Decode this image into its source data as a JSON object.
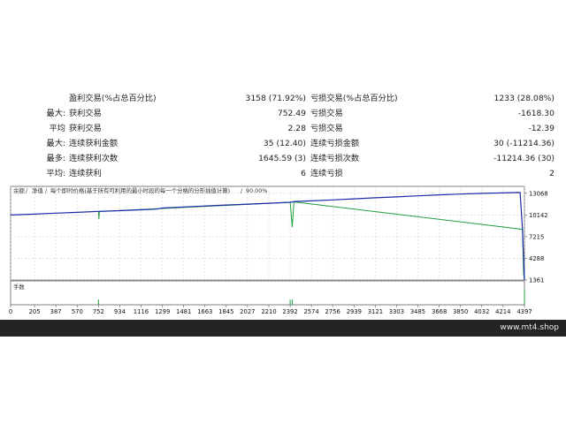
{
  "stats": {
    "rows": [
      {
        "prefix": "",
        "label1": "盈利交易(%占总百分比)",
        "value1": "3158 (71.92%)",
        "label2": "亏损交易(%占总百分比)",
        "value2": "1233 (28.08%)"
      },
      {
        "prefix": "最大:",
        "label1": "获利交易",
        "value1": "752.49",
        "label2": "亏损交易",
        "value2": "-1618.30"
      },
      {
        "prefix": "平均",
        "label1": "获利交易",
        "value1": "2.28",
        "label2": "亏损交易",
        "value2": "-12.39"
      },
      {
        "prefix": "最大:",
        "label1": "连续获利金额",
        "value1": "35 (12.40)",
        "label2": "连续亏损金额",
        "value2": "30 (-11214.36)"
      },
      {
        "prefix": "最多:",
        "label1": "连续获利次数",
        "value1": "1645.59 (3)",
        "label2": "连续亏损次数",
        "value2": "-11214.36 (30)"
      },
      {
        "prefix": "平均:",
        "label1": "连续获利",
        "value1": "6",
        "label2": "连续亏损",
        "value2": "2"
      }
    ]
  },
  "chart": {
    "legend": {
      "balance": "余额",
      "equity": "净值",
      "description": "每个即时价格(基于所有可利用的最小时段的每一个分格的分形插值计算)",
      "quality": "90.00%"
    },
    "volume_label": "手数",
    "colors": {
      "balance": "#1a2aa8",
      "equity": "#22a040",
      "grid": "#c8c8c8",
      "frame": "#606060"
    }
  },
  "chart_data": {
    "type": "line",
    "x_ticks": [
      "0",
      "205",
      "387",
      "570",
      "752",
      "934",
      "1116",
      "1299",
      "1481",
      "1663",
      "1845",
      "2027",
      "2210",
      "2392",
      "2574",
      "2756",
      "2939",
      "3121",
      "3303",
      "3485",
      "3668",
      "3850",
      "4032",
      "4214",
      "4397"
    ],
    "y_ticks": [
      "13068",
      "10142",
      "7215",
      "4288",
      "1361"
    ],
    "xlim": [
      0,
      4397
    ],
    "ylim": [
      1361,
      14000
    ],
    "series": [
      {
        "name": "余额",
        "x": [
          0,
          205,
          387,
          570,
          752,
          934,
          1116,
          1250,
          1299,
          1481,
          1663,
          1845,
          2027,
          2210,
          2392,
          2430,
          2574,
          2756,
          2939,
          3121,
          3303,
          3485,
          3668,
          3850,
          4032,
          4214,
          4340,
          4360,
          4380,
          4397
        ],
        "y": [
          10140,
          10260,
          10390,
          10500,
          10620,
          10720,
          10840,
          10940,
          11080,
          11220,
          11350,
          11480,
          11600,
          11720,
          11850,
          11960,
          12040,
          12180,
          12320,
          12460,
          12580,
          12720,
          12850,
          12960,
          13060,
          13120,
          13180,
          13160,
          8200,
          1361
        ]
      },
      {
        "name": "净值",
        "x": [
          752,
          755,
          760,
          2392,
          2400,
          2410,
          2425,
          4380,
          4390,
          4397
        ],
        "y": [
          10620,
          9600,
          10600,
          11850,
          10500,
          8500,
          11900,
          8200,
          2200,
          1361
        ]
      }
    ],
    "volume_spikes_x": [
      752,
      2392,
      2410,
      4397
    ]
  },
  "footer": {
    "site": "www.mt4.shop"
  }
}
